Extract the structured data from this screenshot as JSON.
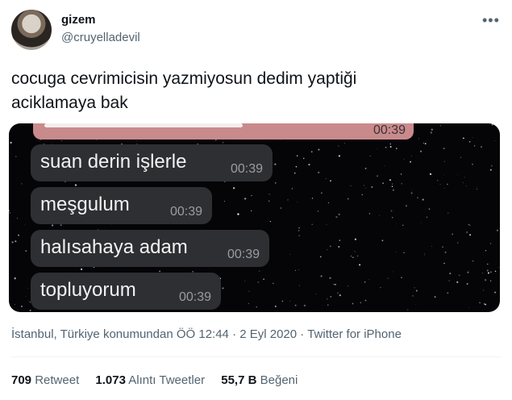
{
  "user": {
    "name": "gizem",
    "handle": "@cruyelladevil"
  },
  "more_icon": "more-horizontal-icon",
  "tweet": {
    "text_line1": "cocuga cevrimicisin yazmiyosun dedim yaptiği",
    "text_line2": "aciklamaya bak"
  },
  "media": {
    "top_time": "00:39",
    "messages": [
      {
        "text": "suan derin işlerle",
        "time": "00:39"
      },
      {
        "text": "meşgulum",
        "time": "00:39"
      },
      {
        "text": "halısahaya adam",
        "time": "00:39"
      },
      {
        "text": "topluyorum",
        "time": "00:39"
      }
    ]
  },
  "meta": {
    "location_time": "İstanbul, Türkiye konumundan ÖÖ 12:44",
    "sep1": "·",
    "date": "2 Eyl 2020",
    "sep2": "·",
    "source": "Twitter for iPhone"
  },
  "stats": {
    "retweets_count": "709",
    "retweets_label": "Retweet",
    "quotes_count": "1.073",
    "quotes_label": "Alıntı Tweetler",
    "likes_count": "55,7 B",
    "likes_label": "Beğeni"
  },
  "colors": {
    "background": "#ffffff",
    "text_primary": "#0f1419",
    "text_secondary": "#536471",
    "bubble": "#2e2f33",
    "top_bubble": "#c98a8c"
  }
}
